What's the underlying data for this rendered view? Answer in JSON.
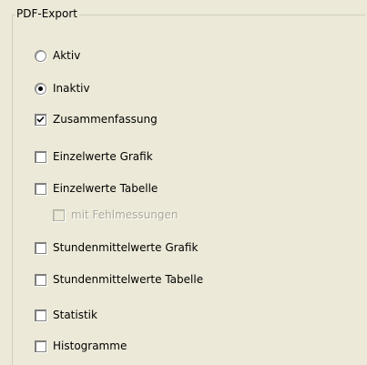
{
  "group": {
    "title": "PDF-Export"
  },
  "mode": {
    "aktiv": {
      "label": "Aktiv",
      "selected": false
    },
    "inaktiv": {
      "label": "Inaktiv",
      "selected": true
    }
  },
  "options": {
    "zusammenfassung": {
      "label": "Zusammenfassung",
      "checked": true
    },
    "einzelwerte_grafik": {
      "label": "Einzelwerte Grafik",
      "checked": false
    },
    "einzelwerte_tabelle": {
      "label": "Einzelwerte Tabelle",
      "checked": false
    },
    "mit_fehlmessungen": {
      "label": "mit Fehlmessungen",
      "checked": false,
      "enabled": false
    },
    "stundenmittelwerte_grafik": {
      "label": "Stundenmittelwerte Grafik",
      "checked": false
    },
    "stundenmittelwerte_tabelle": {
      "label": "Stundenmittelwerte Tabelle",
      "checked": false
    },
    "statistik": {
      "label": "Statistik",
      "checked": false
    },
    "histogramme": {
      "label": "Histogramme",
      "checked": false
    }
  }
}
